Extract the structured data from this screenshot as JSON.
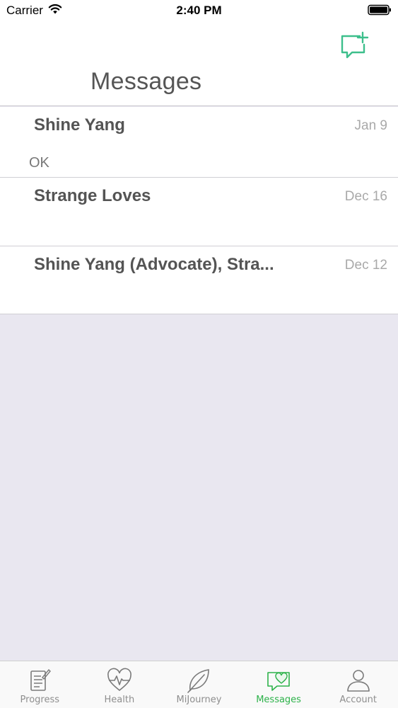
{
  "status_bar": {
    "carrier": "Carrier",
    "time": "2:40 PM"
  },
  "header": {
    "title": "Messages",
    "compose_icon": "compose-message-icon"
  },
  "conversations": [
    {
      "name": "Shine Yang",
      "date": "Jan 9",
      "preview": "OK"
    },
    {
      "name": "Strange Loves",
      "date": "Dec 16",
      "preview": ""
    },
    {
      "name": "Shine Yang (Advocate),  Stra...",
      "date": "Dec 12",
      "preview": ""
    }
  ],
  "tabs": [
    {
      "label": "Progress",
      "icon": "progress-icon",
      "active": false
    },
    {
      "label": "Health",
      "icon": "heart-pulse-icon",
      "active": false
    },
    {
      "label": "MiJourney",
      "icon": "leaf-icon",
      "active": false
    },
    {
      "label": "Messages",
      "icon": "chat-heart-icon",
      "active": true
    },
    {
      "label": "Account",
      "icon": "person-icon",
      "active": false
    }
  ],
  "colors": {
    "accent": "#2db24a",
    "compose": "#3dbf8c",
    "background": "#e9e7f0"
  }
}
